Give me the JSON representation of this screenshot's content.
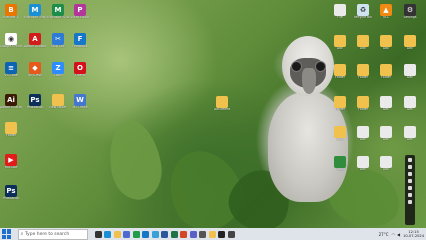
{
  "desktop": {
    "icons_left": [
      {
        "label": "Blender 4",
        "color": "#ea7600",
        "glyph": "B"
      },
      {
        "label": "Microsoft Edge",
        "color": "#1b8fd6",
        "glyph": "M"
      },
      {
        "label": "Microsoft Studio",
        "color": "#1e8d4a",
        "glyph": "M"
      },
      {
        "label": "Video Editor",
        "color": "#b3379b",
        "glyph": "P"
      },
      {
        "label": "Google Chrome",
        "color": "#ffffff",
        "glyph": "◉"
      },
      {
        "label": "Adobe Acrobat",
        "color": "#d21b1b",
        "glyph": "A"
      },
      {
        "label": "Snip Tool",
        "color": "#2d7bd6",
        "glyph": "✂"
      },
      {
        "label": "Feedback",
        "color": "#1676c7",
        "glyph": "F"
      },
      {
        "label": "VS Code",
        "color": "#0c64b3",
        "glyph": "≡"
      },
      {
        "label": "AnyDesk",
        "color": "#e7591b",
        "glyph": "◆"
      },
      {
        "label": "Zoom",
        "color": "#2d8cff",
        "glyph": "Z"
      },
      {
        "label": "Opera",
        "color": "#d3111b",
        "glyph": "O"
      },
      {
        "label": "Adobe Illustrator",
        "color": "#3b1b06",
        "glyph": "Ai"
      },
      {
        "label": "Photoshop",
        "color": "#0c2f5a",
        "glyph": "Ps"
      },
      {
        "label": "New folder",
        "color": "#f1c14d",
        "glyph": ""
      },
      {
        "label": "MS Office",
        "color": "#4477d1",
        "glyph": "W"
      },
      {
        "label": "Folder",
        "color": "#f1c14d",
        "glyph": ""
      },
      {
        "label": "YouTube",
        "color": "#e21b1b",
        "glyph": "▶"
      },
      {
        "label": "Photoshop",
        "color": "#0c2f5a",
        "glyph": "Ps"
      }
    ],
    "icons_right": [
      {
        "label": "File",
        "color": "#eaeaea",
        "glyph": ""
      },
      {
        "label": "Recycle Bin",
        "color": "#cfe3f1",
        "glyph": "♻"
      },
      {
        "label": "VLC",
        "color": "#f18a12",
        "glyph": "▲"
      },
      {
        "label": "Settings",
        "color": "#333333",
        "glyph": "⚙"
      },
      {
        "label": "Doc",
        "color": "#f1c14d",
        "glyph": ""
      },
      {
        "label": "Doc",
        "color": "#f1c14d",
        "glyph": ""
      },
      {
        "label": "Doc",
        "color": "#f1c14d",
        "glyph": ""
      },
      {
        "label": "Doc",
        "color": "#f1c14d",
        "glyph": ""
      },
      {
        "label": "Folder",
        "color": "#f1c14d",
        "glyph": ""
      },
      {
        "label": "Folder",
        "color": "#f1c14d",
        "glyph": ""
      },
      {
        "label": "Folder",
        "color": "#f1c14d",
        "glyph": ""
      },
      {
        "label": "Doc",
        "color": "#eaeaea",
        "glyph": ""
      },
      {
        "label": "Folder",
        "color": "#f1c14d",
        "glyph": ""
      },
      {
        "label": "Folder",
        "color": "#f1c14d",
        "glyph": ""
      },
      {
        "label": "Doc",
        "color": "#eaeaea",
        "glyph": ""
      },
      {
        "label": "Doc",
        "color": "#eaeaea",
        "glyph": ""
      },
      {
        "label": "Doc",
        "color": "#f1c14d",
        "glyph": ""
      },
      {
        "label": "Doc",
        "color": "#eaeaea",
        "glyph": ""
      },
      {
        "label": "Doc",
        "color": "#eaeaea",
        "glyph": ""
      },
      {
        "label": "Doc",
        "color": "#eaeaea",
        "glyph": ""
      },
      {
        "label": "Doc",
        "color": "#2f8d3b",
        "glyph": ""
      },
      {
        "label": "Doc",
        "color": "#eaeaea",
        "glyph": ""
      },
      {
        "label": "Doc",
        "color": "#eaeaea",
        "glyph": ""
      }
    ],
    "center_icon": {
      "label": "Document",
      "color": "#f1c14d",
      "glyph": ""
    }
  },
  "taskbar": {
    "search_placeholder": "Type here to search",
    "apps": [
      {
        "name": "task-view",
        "color": "#333333"
      },
      {
        "name": "edge",
        "color": "#1b8fd6"
      },
      {
        "name": "explorer",
        "color": "#f1c14d"
      },
      {
        "name": "store",
        "color": "#4f6bd1"
      },
      {
        "name": "chrome",
        "color": "#1f9d4a"
      },
      {
        "name": "mail",
        "color": "#1676c7"
      },
      {
        "name": "photos",
        "color": "#3aa0d8"
      },
      {
        "name": "word",
        "color": "#2b579a"
      },
      {
        "name": "excel",
        "color": "#217346"
      },
      {
        "name": "powerpoint",
        "color": "#d24726"
      },
      {
        "name": "teams",
        "color": "#5b5fc7"
      },
      {
        "name": "settings",
        "color": "#555555"
      },
      {
        "name": "folder",
        "color": "#f1c14d"
      },
      {
        "name": "camera",
        "color": "#222222"
      },
      {
        "name": "calc",
        "color": "#444444"
      }
    ],
    "weather": "27°C",
    "time": "12:15",
    "date": "10-07-2024"
  }
}
